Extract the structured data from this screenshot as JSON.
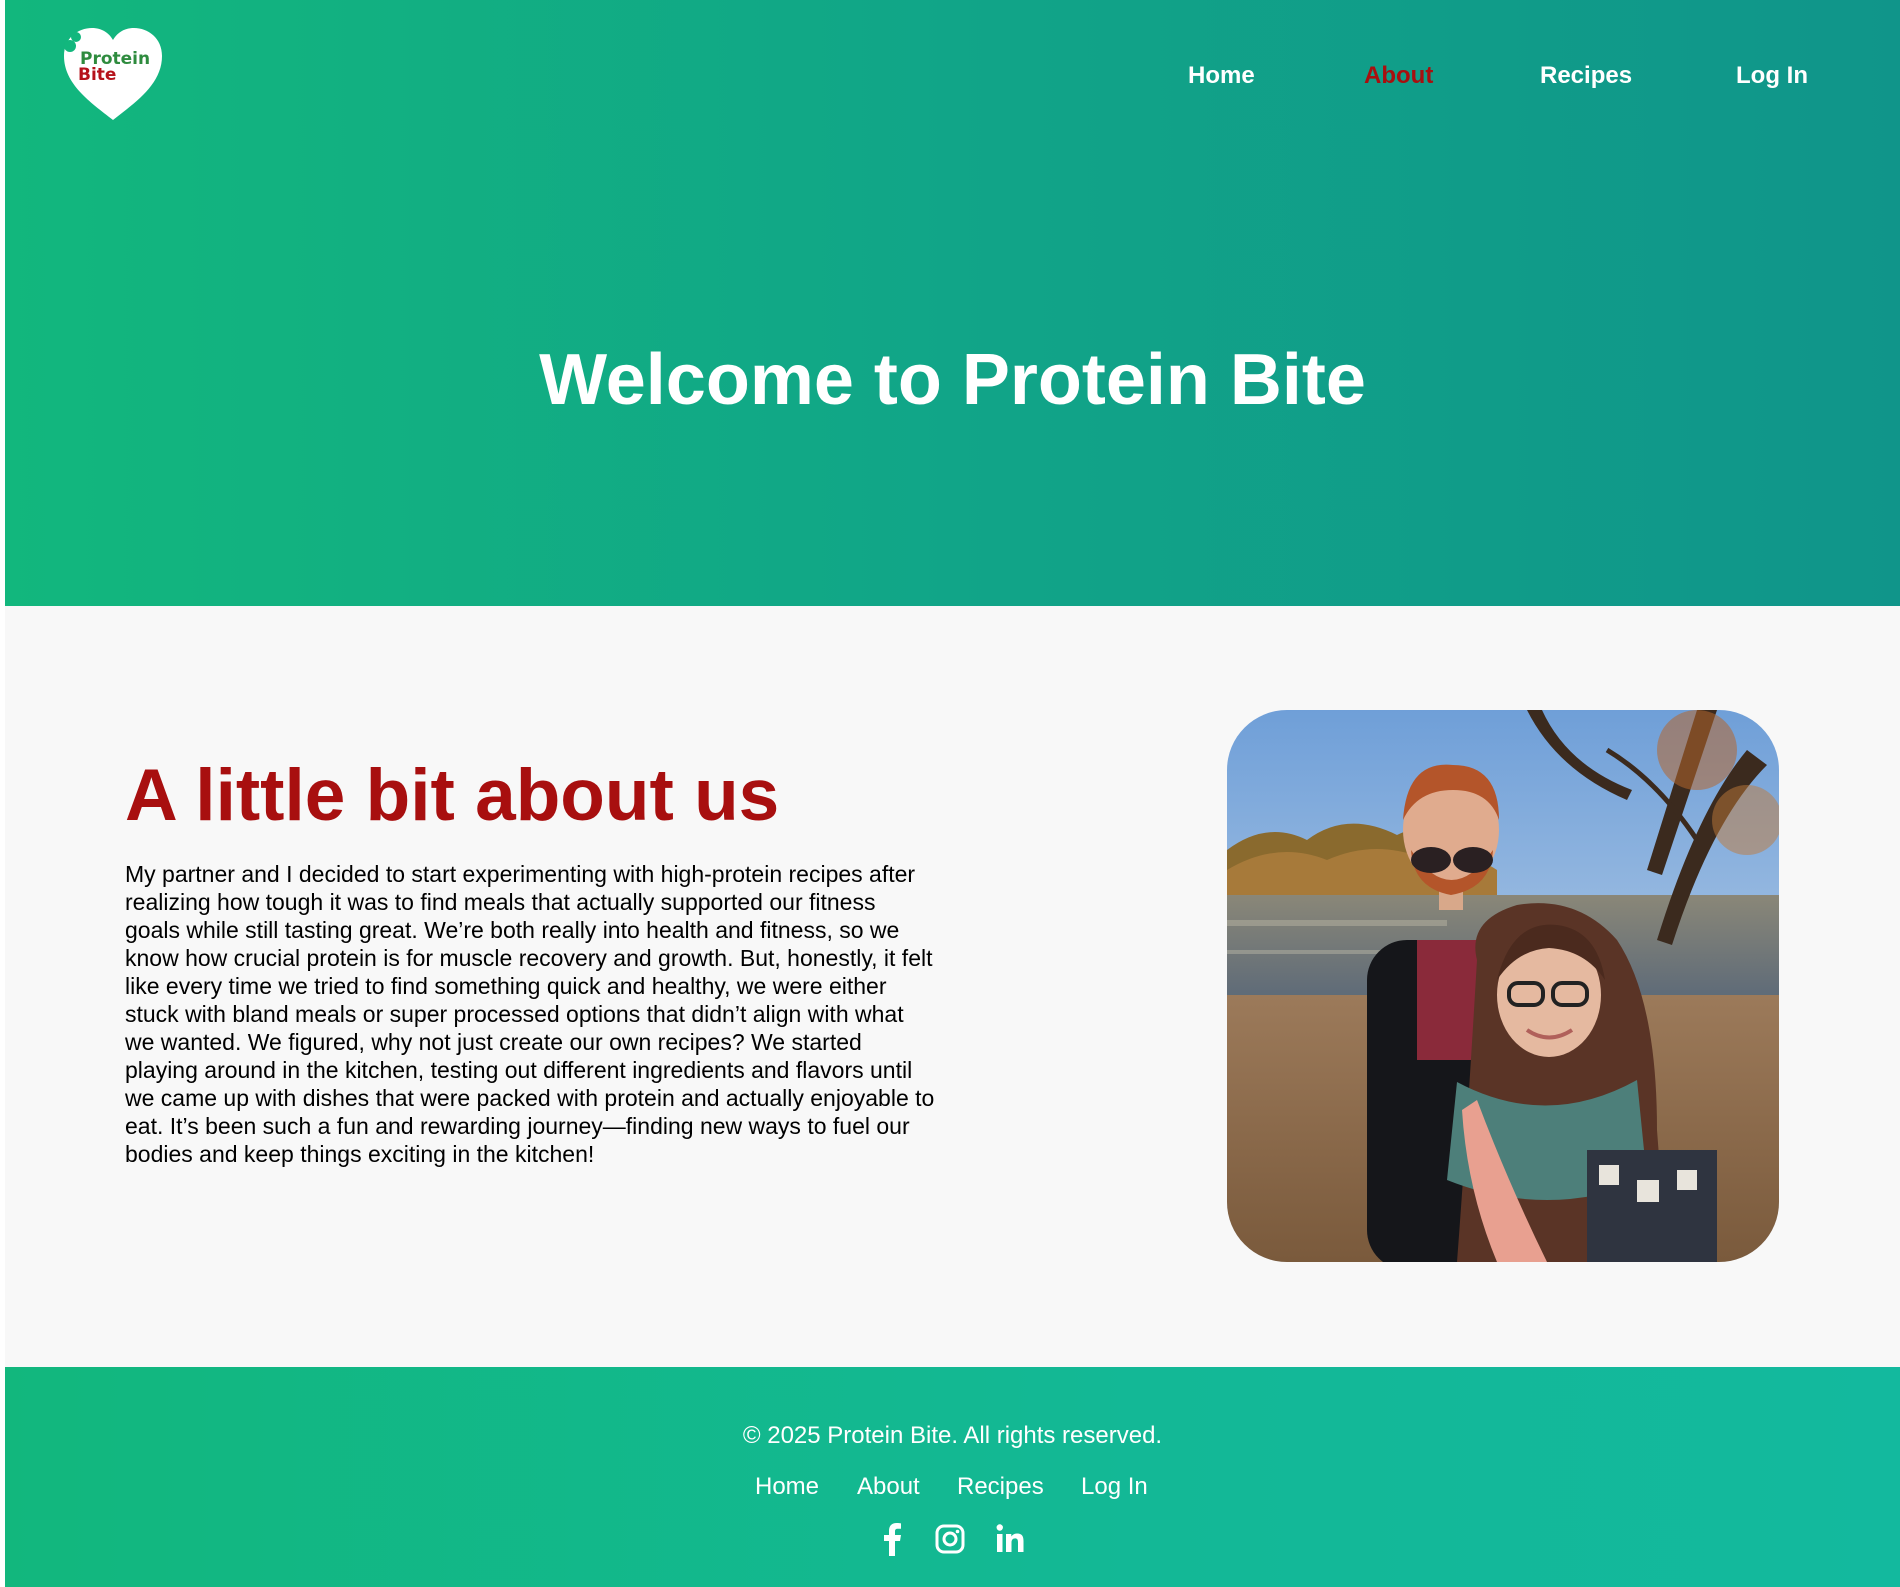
{
  "brand": {
    "logo_line1": "Protein",
    "logo_line2": "Bite"
  },
  "nav": {
    "items": [
      {
        "label": "Home",
        "active": false
      },
      {
        "label": "About",
        "active": true
      },
      {
        "label": "Recipes",
        "active": false
      },
      {
        "label": "Log In",
        "active": false
      }
    ]
  },
  "hero": {
    "title": "Welcome to Protein Bite"
  },
  "about": {
    "heading": "A little bit about us",
    "body": "My partner and I decided to start experimenting with high-protein recipes after realizing how tough it was to find meals that actually supported our fitness goals while still tasting great. We’re both really into health and fitness, so we know how crucial protein is for muscle recovery and growth. But, honestly, it felt like every time we tried to find something quick and healthy, we were either stuck with bland meals or super processed options that didn’t align with what we wanted. We figured, why not just create our own recipes? We started playing around in the kitchen, testing out different ingredients and flavors until we came up with dishes that were packed with protein and actually enjoyable to eat. It’s been such a fun and rewarding journey—finding new ways to fuel our bodies and keep things exciting in the kitchen!"
  },
  "footer": {
    "copyright": "© 2025 Protein Bite. All rights reserved.",
    "links": [
      {
        "label": "Home"
      },
      {
        "label": "About"
      },
      {
        "label": "Recipes"
      },
      {
        "label": "Log In"
      }
    ],
    "socials": [
      {
        "icon": "facebook-icon"
      },
      {
        "icon": "instagram-icon"
      },
      {
        "icon": "linkedin-icon"
      }
    ]
  },
  "colors": {
    "hero_start": "#12b77d",
    "hero_end": "#10958a",
    "accent_red": "#a80f0f",
    "about_bg": "#f8f8f8",
    "footer": "#13b896"
  }
}
